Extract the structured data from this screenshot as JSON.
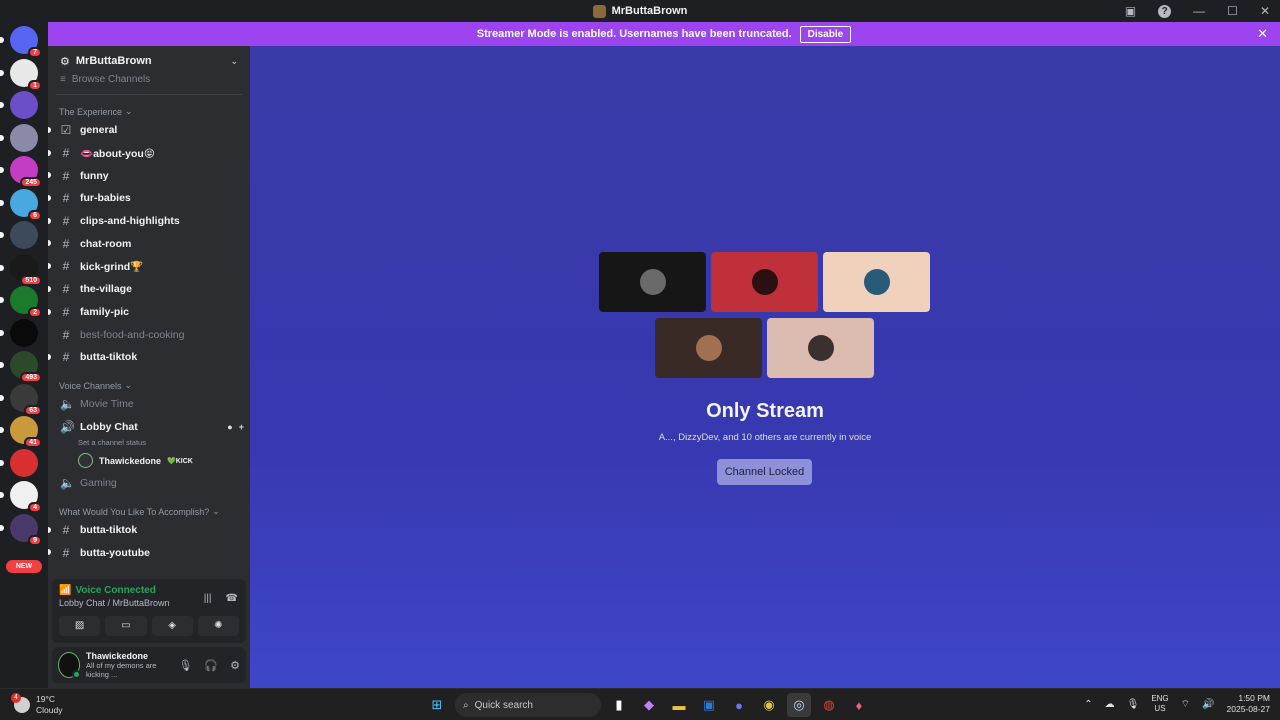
{
  "window": {
    "title": "MrButtaBrown"
  },
  "notice": {
    "text": "Streamer Mode is enabled. Usernames have been truncated.",
    "button": "Disable"
  },
  "rail": {
    "servers": [
      {
        "color": "#5865f2",
        "badge": "7",
        "icon": "discord-home-icon"
      },
      {
        "color": "#e8e8e8",
        "badge": "1",
        "icon": "server-avatar-icon"
      },
      {
        "color": "#6a4fc9",
        "badge": "",
        "icon": "server-avatar-icon"
      },
      {
        "color": "#8a8aa8",
        "badge": "",
        "icon": "server-avatar-icon"
      },
      {
        "color": "#c43cc4",
        "badge": "245",
        "icon": "server-avatar-icon"
      },
      {
        "color": "#4aa8e0",
        "badge": "6",
        "icon": "server-avatar-icon"
      },
      {
        "color": "#3c4a5c",
        "badge": "",
        "icon": "server-avatar-icon"
      },
      {
        "color": "#1a1a1a",
        "badge": "510",
        "icon": "server-avatar-icon"
      },
      {
        "color": "#1c7a2c",
        "badge": "2",
        "icon": "server-avatar-icon"
      },
      {
        "color": "#0a0a0a",
        "badge": "",
        "icon": "server-avatar-icon"
      },
      {
        "color": "#2a4a2a",
        "badge": "493",
        "icon": "server-avatar-icon"
      },
      {
        "color": "#3a3a3a",
        "badge": "63",
        "icon": "server-avatar-icon"
      },
      {
        "color": "#c89a3c",
        "badge": "41",
        "icon": "server-avatar-icon"
      },
      {
        "color": "#d83030",
        "badge": "",
        "icon": "server-avatar-icon"
      },
      {
        "color": "#f0f0f0",
        "badge": "4",
        "icon": "server-avatar-icon"
      },
      {
        "color": "#4a3a6a",
        "badge": "9",
        "icon": "server-avatar-icon"
      }
    ],
    "new_label": "NEW"
  },
  "guild": {
    "name": "MrButtaBrown",
    "browse": "Browse Channels",
    "categories": [
      {
        "name": "The Experience",
        "channels": [
          {
            "name": "general",
            "style": "unread",
            "icon": "rules-icon"
          },
          {
            "name": "👄about-you😝",
            "style": "unread",
            "icon": "hash-icon"
          },
          {
            "name": "funny",
            "style": "unread",
            "icon": "hash-icon"
          },
          {
            "name": "fur-babies",
            "style": "unread",
            "icon": "hash-icon"
          },
          {
            "name": "clips-and-highlights",
            "style": "unread",
            "icon": "hash-icon"
          },
          {
            "name": "chat-room",
            "style": "unread",
            "icon": "hash-icon"
          },
          {
            "name": "kick-grind🏆",
            "style": "unread",
            "icon": "hash-icon"
          },
          {
            "name": "the-village",
            "style": "unread",
            "icon": "hash-icon"
          },
          {
            "name": "family-pic",
            "style": "unread",
            "icon": "hash-icon"
          },
          {
            "name": "best-food-and-cooking",
            "style": "muted",
            "icon": "hash-icon"
          },
          {
            "name": "butta-tiktok",
            "style": "unread",
            "icon": "hash-icon"
          }
        ]
      }
    ],
    "voice_category": "Voice Channels",
    "voice": {
      "movie": "Movie Time",
      "lobby": "Lobby Chat",
      "lobby_status": "Set a channel status",
      "user": "Thawickedone",
      "user_tag": "💚KICK",
      "gaming": "Gaming"
    },
    "goals_category": "What Would You Like To Accomplish?",
    "goals_channels": [
      "butta-tiktok",
      "butta-youtube"
    ]
  },
  "voice_panel": {
    "title": "Voice Connected",
    "sub": "Lobby Chat / MrButtaBrown"
  },
  "user_panel": {
    "name": "Thawickedone",
    "status": "All of my demons are kicking ..."
  },
  "stage": {
    "title": "Only Stream",
    "subtitle": "A..., DizzyDev, and 10 others are currently in voice",
    "button": "Channel Locked",
    "tiles": [
      {
        "bg": "#161616",
        "av": "#6a6a6a"
      },
      {
        "bg": "#c0303a",
        "av": "#2a1010"
      },
      {
        "bg": "#f0d2bc",
        "av": "#2a5a7a"
      },
      {
        "bg": "#3a2a26",
        "av": "#a07050"
      },
      {
        "bg": "#dcbcb0",
        "av": "#3a3030"
      }
    ]
  },
  "taskbar": {
    "weather_temp": "19°C",
    "weather_desc": "Cloudy",
    "weather_badge": "4",
    "search": "Quick search",
    "lang1": "ENG",
    "lang2": "US",
    "time": "1:50 PM",
    "date": "2025-08-27"
  }
}
